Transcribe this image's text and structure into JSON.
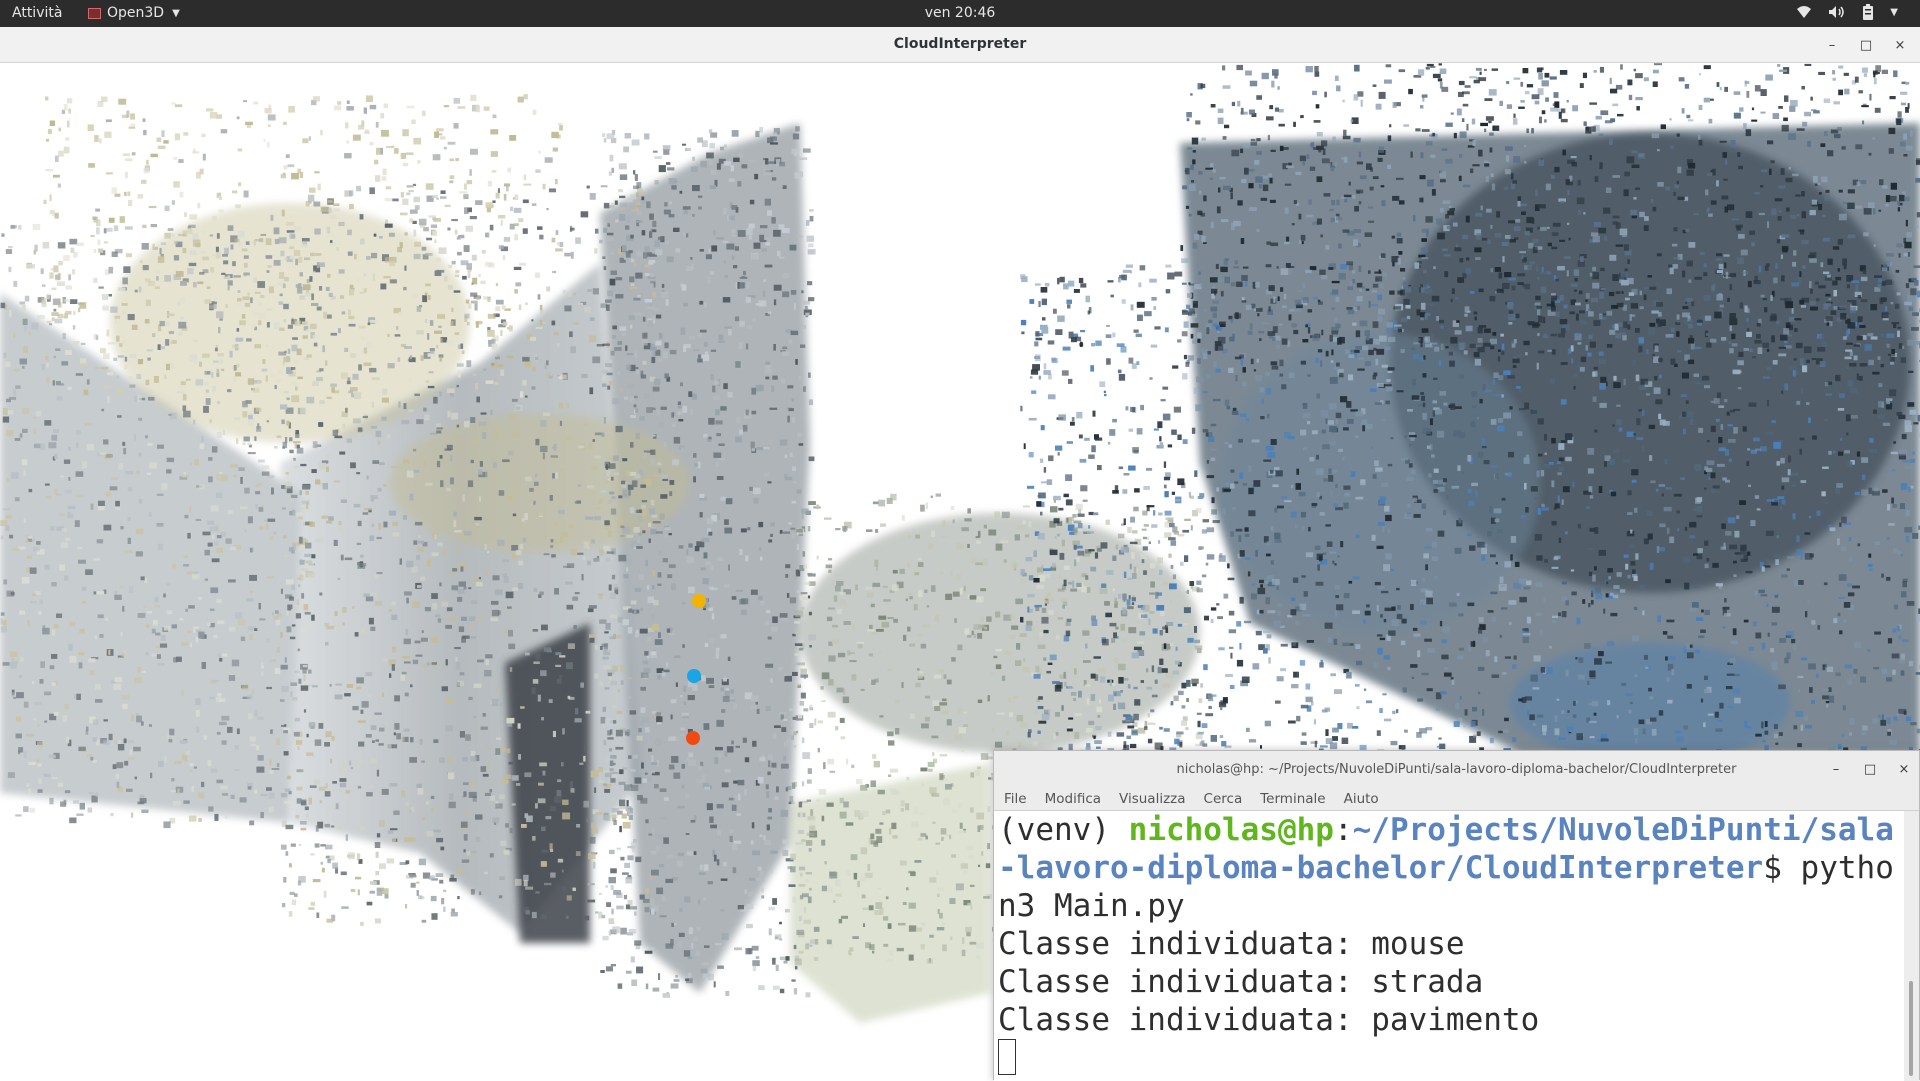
{
  "topbar": {
    "activities": "Attività",
    "app_name": "Open3D",
    "clock": "ven 20:46",
    "tray_icons": [
      "wifi-icon",
      "volume-icon",
      "battery-icon"
    ]
  },
  "open3d_window": {
    "title": "CloudInterpreter",
    "controls": [
      "minimize",
      "maximize",
      "close"
    ]
  },
  "viewport": {
    "picked_points": [
      {
        "color": "#f2b400",
        "label": "yellow"
      },
      {
        "color": "#1aa6e6",
        "label": "blue"
      },
      {
        "color": "#f04a12",
        "label": "red"
      }
    ]
  },
  "terminal": {
    "title": "nicholas@hp: ~/Projects/NuvoleDiPunti/sala-lavoro-diploma-bachelor/CloudInterpreter",
    "menu": [
      "File",
      "Modifica",
      "Visualizza",
      "Cerca",
      "Terminale",
      "Aiuto"
    ],
    "prompt": {
      "venv": "(venv) ",
      "user_host": "nicholas@hp",
      "sep": ":",
      "path_line1": "~/Projects/NuvoleDiPunti/sala",
      "path_line2": "-lavoro-diploma-bachelor/CloudInterpreter",
      "dollar": "$ ",
      "cmd_line2": "pytho",
      "cmd_line3": "n3 Main.py"
    },
    "output": [
      "Classe individuata: mouse",
      "Classe individuata: strada",
      "Classe individuata: pavimento"
    ]
  }
}
